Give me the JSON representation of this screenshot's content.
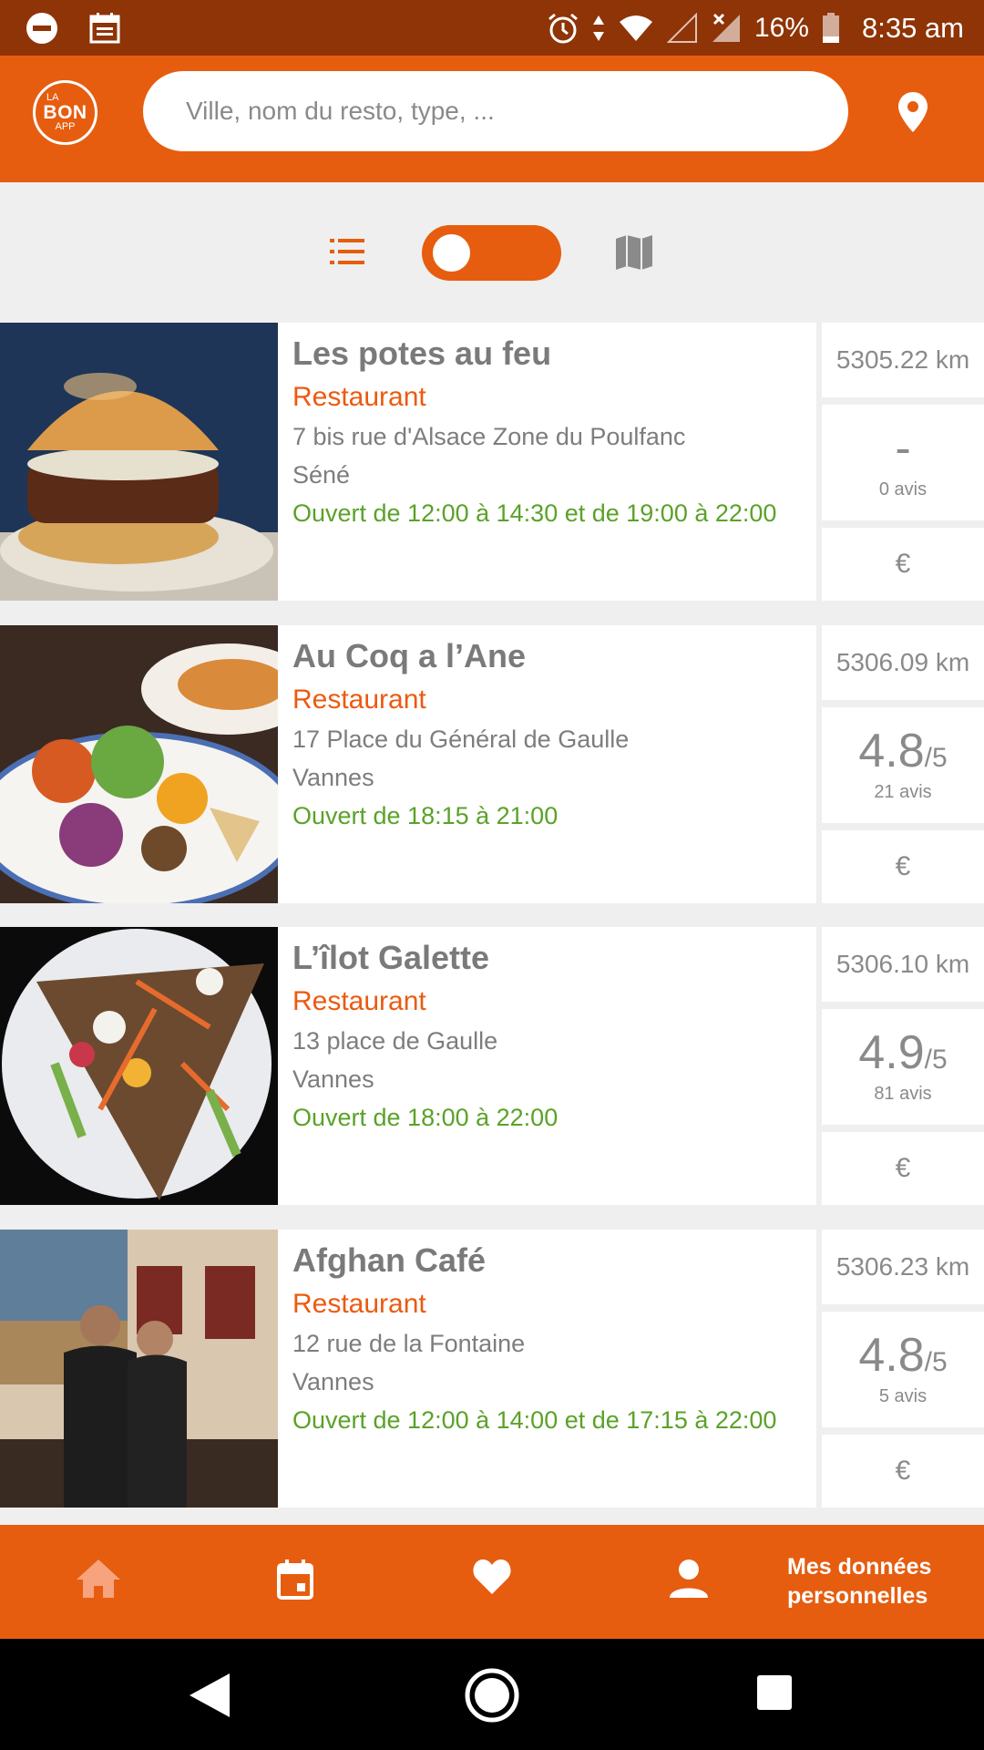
{
  "status_bar": {
    "battery": "16%",
    "time": "8:35 am"
  },
  "app_bar": {
    "logo": {
      "line1": "LA",
      "line2": "BON",
      "line3": "APP"
    },
    "search_placeholder": "Ville, nom du resto, type, ..."
  },
  "view_toggle": {
    "mode": "list",
    "icons": [
      "list-icon",
      "map-icon"
    ]
  },
  "restaurants": [
    {
      "name": "Les potes au feu",
      "type": "Restaurant",
      "address": "7 bis rue d'Alsace Zone du Poulfanc",
      "city": "Séné",
      "hours": "Ouvert de 12:00 à 14:30 et de 19:00 à 22:00",
      "distance": "5305.22 km",
      "rating": "-",
      "rating_out_of": "",
      "reviews": "0 avis",
      "price": "€"
    },
    {
      "name": "Au Coq a l’Ane",
      "type": "Restaurant",
      "address": "17 Place du Général de Gaulle",
      "city": "Vannes",
      "hours": "Ouvert de 18:15 à 21:00",
      "distance": "5306.09 km",
      "rating": "4.8",
      "rating_out_of": "/5",
      "reviews": "21 avis",
      "price": "€"
    },
    {
      "name": "L’îlot Galette",
      "type": "Restaurant",
      "address": "13 place de Gaulle",
      "city": "Vannes",
      "hours": "Ouvert de 18:00 à 22:00",
      "distance": "5306.10 km",
      "rating": "4.9",
      "rating_out_of": "/5",
      "reviews": "81 avis",
      "price": "€"
    },
    {
      "name": "Afghan Café",
      "type": "Restaurant",
      "address": "12 rue de la Fontaine",
      "city": "Vannes",
      "hours": "Ouvert de 12:00 à 14:00 et de 17:15 à 22:00",
      "distance": "5306.23 km",
      "rating": "4.8",
      "rating_out_of": "/5",
      "reviews": "5 avis",
      "price": "€"
    }
  ],
  "bottom_nav": {
    "items": [
      "home-icon",
      "calendar-icon",
      "heart-icon",
      "person-icon"
    ],
    "label_line1": "Mes données",
    "label_line2": "personnelles"
  },
  "colors": {
    "accent": "#e65d0f",
    "status_bar": "#8e3407",
    "open_hours": "#5aa228",
    "type_text": "#ec5a10"
  }
}
